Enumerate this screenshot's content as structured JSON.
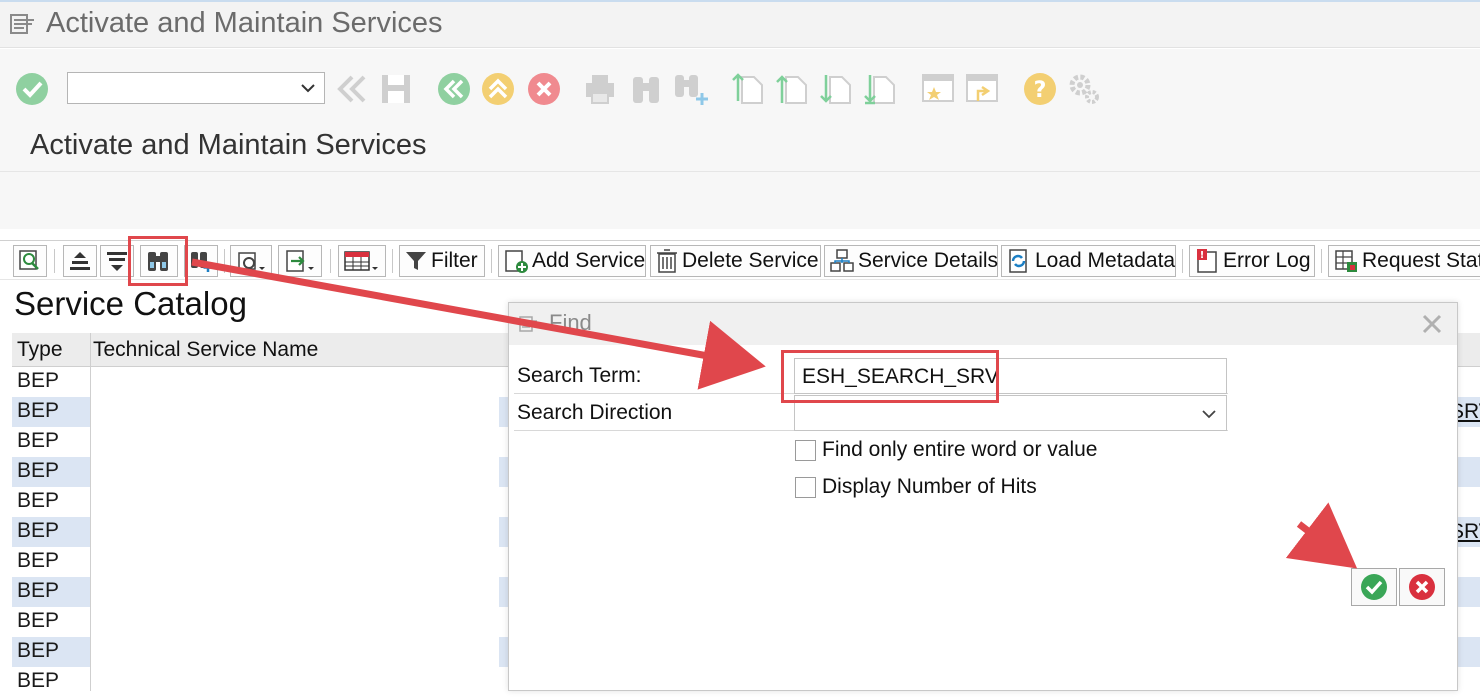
{
  "window": {
    "title": "Activate and Maintain Services"
  },
  "command_field": {
    "value": ""
  },
  "page": {
    "title": "Activate and Maintain Services"
  },
  "app_toolbar": {
    "filter_label": "Filter",
    "add_service_label": "Add Service",
    "delete_service_label": "Delete Service",
    "service_details_label": "Service Details",
    "load_metadata_label": "Load Metadata",
    "error_log_label": "Error Log",
    "request_status_label": "Request Stat"
  },
  "catalog": {
    "title": "Service Catalog",
    "columns": [
      "Type",
      "Technical Service Name"
    ],
    "rows": [
      "BEP",
      "BEP",
      "BEP",
      "BEP",
      "BEP",
      "BEP",
      "BEP",
      "BEP",
      "BEP",
      "BEP",
      "BEP"
    ],
    "right_fragments": [
      "SRV",
      "SRV"
    ]
  },
  "find_dialog": {
    "title": "Find",
    "search_term_label": "Search Term:",
    "search_term_value": "ESH_SEARCH_SRV",
    "search_direction_label": "Search Direction",
    "search_direction_value": "",
    "option_entire_word": "Find only entire word or value",
    "option_number_of_hits": "Display Number of Hits",
    "option_entire_word_checked": false,
    "option_number_of_hits_checked": false
  },
  "colors": {
    "accent_green": "#3aa657",
    "cancel_red": "#d9303e",
    "annotation_red": "#e0474c",
    "row_stripe": "#dbe5f3",
    "toolbar_gray": "#f7f7f7"
  }
}
